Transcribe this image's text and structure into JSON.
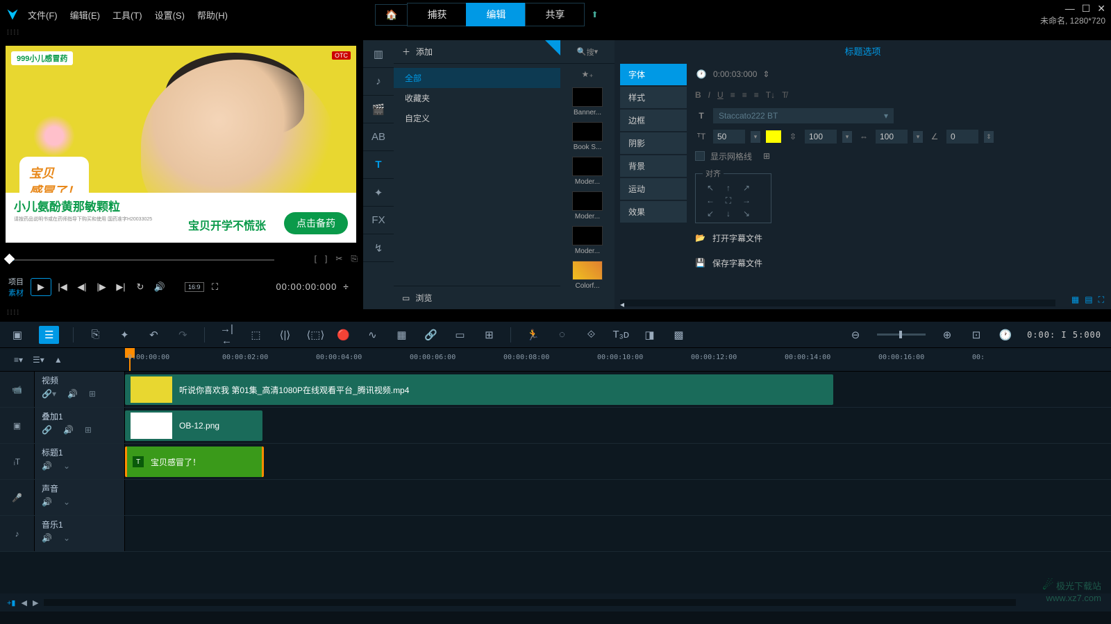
{
  "menu": {
    "file": "文件(F)",
    "edit": "编辑(E)",
    "tools": "工具(T)",
    "settings": "设置(S)",
    "help": "帮助(H)"
  },
  "topTabs": {
    "capture": "捕获",
    "edit": "编辑",
    "share": "共享"
  },
  "status": "未命名, 1280*720",
  "preview": {
    "brand": "999小儿感冒药",
    "otc": "OTC",
    "bubble": "宝贝\n感冒了！",
    "product": "小儿氨酚黄那敏颗粒",
    "slogan": "宝贝开学不慌张",
    "button": "点击备药"
  },
  "transport": {
    "proj": "项目",
    "mat": "素材",
    "aspect": "16:9",
    "tc": "00:00:00:000"
  },
  "library": {
    "add": "添加",
    "all": "全部",
    "fav": "收藏夹",
    "custom": "自定义",
    "browse": "浏览",
    "search": "搜"
  },
  "thumbs": [
    "Banner...",
    "Book S...",
    "Moder...",
    "Moder...",
    "Moder...",
    "Colorf..."
  ],
  "props": {
    "title": "标题选项",
    "duration": "0:00:03:000",
    "tabs": {
      "font": "字体",
      "style": "样式",
      "border": "边框",
      "shadow": "阴影",
      "bg": "背景",
      "motion": "运动",
      "fx": "效果"
    },
    "fontName": "Staccato222 BT",
    "size": "50",
    "lineH": "100",
    "kern": "100",
    "rot": "0",
    "grid": "显示网格线",
    "align": "对齐",
    "openSub": "打开字幕文件",
    "saveSub": "保存字幕文件"
  },
  "toolbar": {
    "tc": "0:00: I 5:000"
  },
  "ruler": [
    "0:00:00:00",
    "00:00:02:00",
    "00:00:04:00",
    "00:00:06:00",
    "00:00:08:00",
    "00:00:10:00",
    "00:00:12:00",
    "00:00:14:00",
    "00:00:16:00",
    "00:"
  ],
  "tracks": {
    "video": {
      "name": "视频",
      "clip": "听说你喜欢我 第01集_高清1080P在线观看平台_腾讯视频.mp4"
    },
    "overlay": {
      "name": "叠加1",
      "clip": "OB-12.png"
    },
    "title": {
      "name": "标题1",
      "clip": "宝贝感冒了！"
    },
    "voice": {
      "name": "声音"
    },
    "music": {
      "name": "音乐1"
    }
  },
  "watermark": {
    "name": "极光下载站",
    "url": "www.xz7.com"
  }
}
